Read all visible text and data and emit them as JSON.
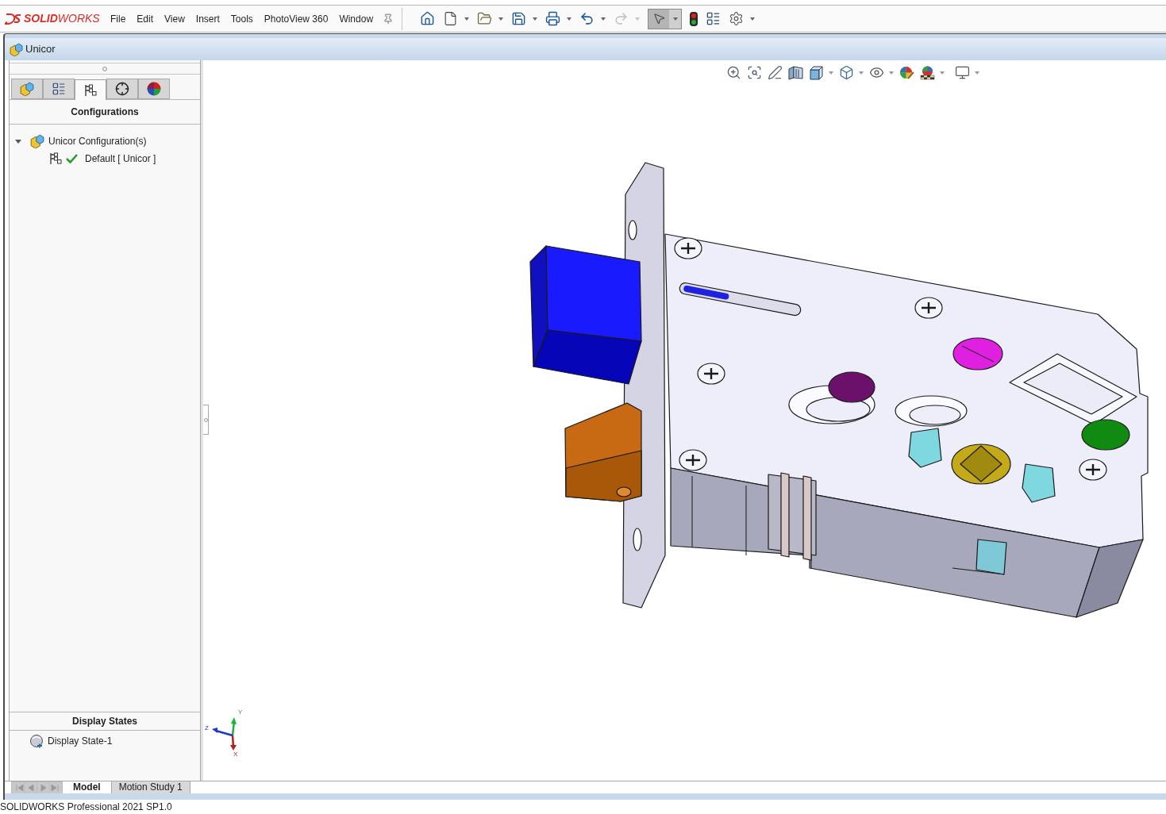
{
  "app": {
    "logo": "**SOLID**WORKS"
  },
  "menu": [
    "File",
    "Edit",
    "View",
    "Insert",
    "Tools",
    "PhotoView 360",
    "Window"
  ],
  "quick_access_toolbar": {
    "redo_disabled": true,
    "select_active": true
  },
  "document": {
    "title": "Unicor"
  },
  "panel_tabs": [
    {
      "selected": false
    },
    {
      "selected": false
    },
    {
      "selected": true
    },
    {
      "selected": false
    },
    {
      "selected": false
    }
  ],
  "configurations": {
    "heading": "Configurations",
    "tree": [
      {
        "label": "Unicor Configuration(s)",
        "expanded": true,
        "children": [
          {
            "label": "Default [ Unicor ]",
            "active": true
          }
        ]
      }
    ]
  },
  "display_states": {
    "heading": "Display States",
    "items": [
      {
        "label": "Display State-1"
      }
    ]
  },
  "triad": {
    "x": "X",
    "y": "Y",
    "z": "Z"
  },
  "bottom_tabs": [
    {
      "label": "Model",
      "selected": true
    },
    {
      "label": "Motion Study 1",
      "selected": false
    }
  ],
  "status_bar": {
    "text": "SOLIDWORKS Professional 2021 SP1.0"
  }
}
